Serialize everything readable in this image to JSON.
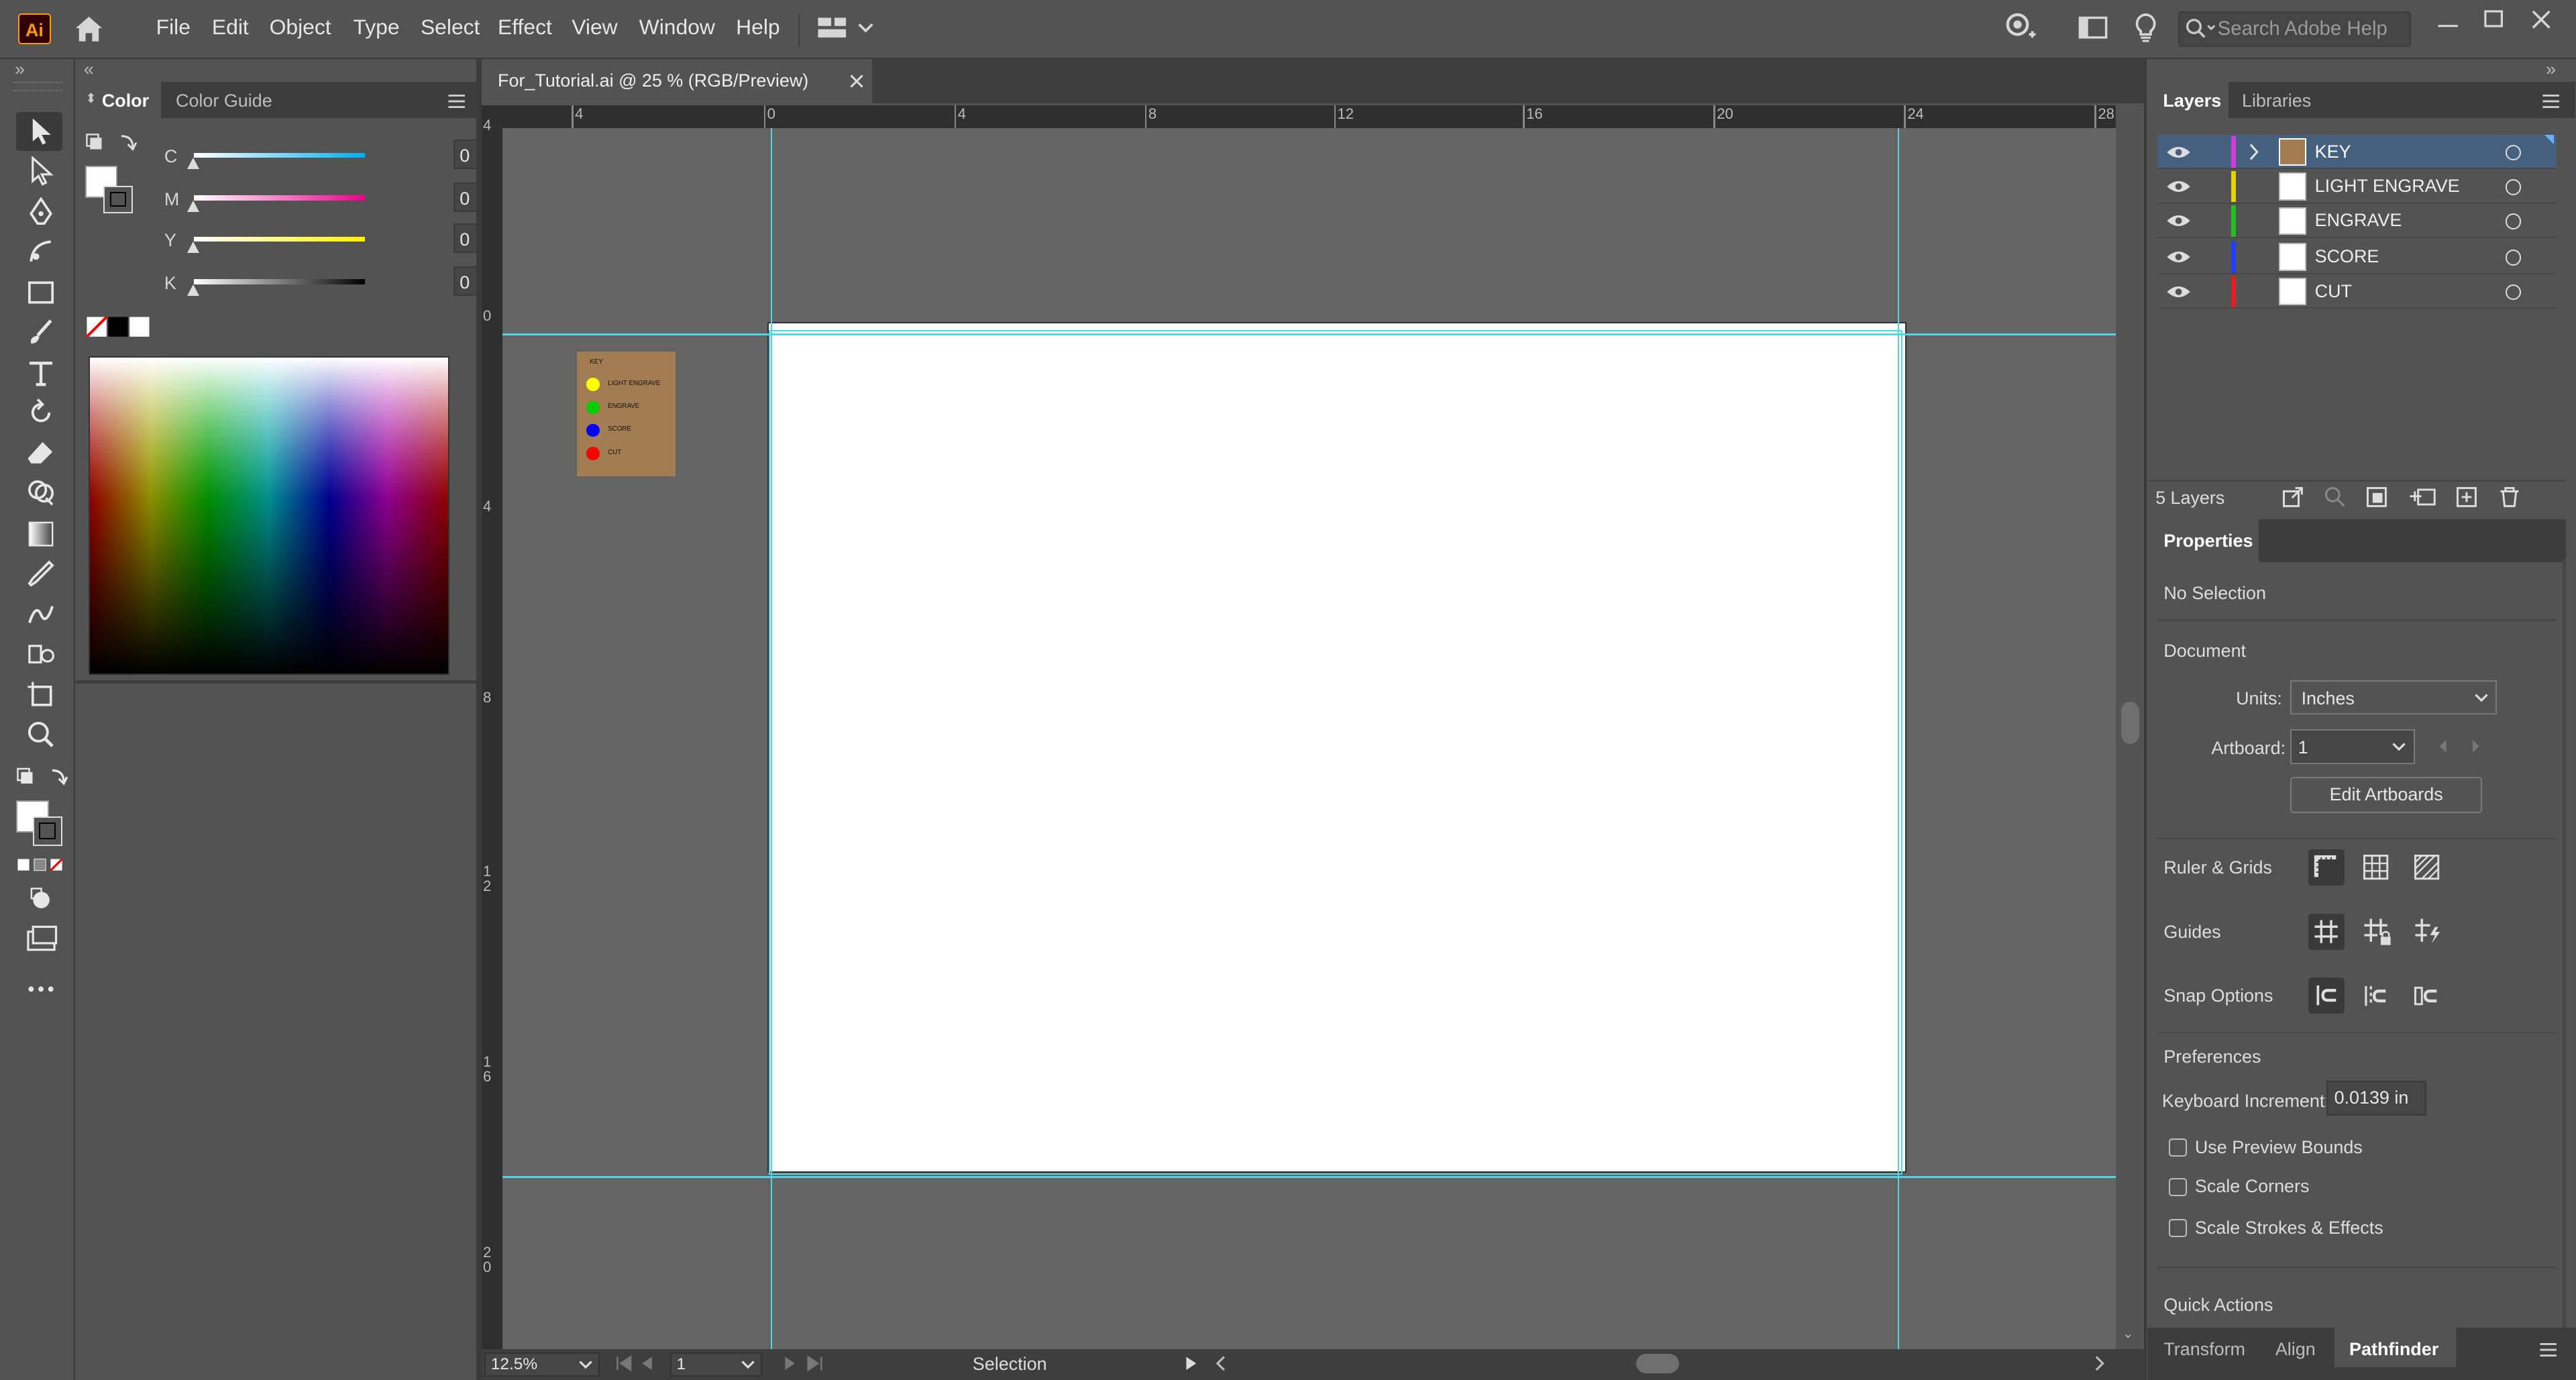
{
  "app": {
    "logo": "Ai"
  },
  "menu": [
    "File",
    "Edit",
    "Object",
    "Type",
    "Select",
    "Effect",
    "View",
    "Window",
    "Help"
  ],
  "search": {
    "placeholder": "Search Adobe Help"
  },
  "left_panel": {
    "tabs": [
      "Color",
      "Color Guide"
    ],
    "channels": [
      {
        "label": "C",
        "value": "0",
        "unit": "%"
      },
      {
        "label": "M",
        "value": "0",
        "unit": "%"
      },
      {
        "label": "Y",
        "value": "0",
        "unit": "%"
      },
      {
        "label": "K",
        "value": "0",
        "unit": "%"
      }
    ]
  },
  "document": {
    "tab_title": "For_Tutorial.ai @ 25 % (RGB/Preview)",
    "h_ruler": [
      "4",
      "0",
      "4",
      "8",
      "12",
      "16",
      "20",
      "24",
      "28"
    ],
    "v_ruler": [
      "4",
      "0",
      "4",
      "8",
      "1\n2",
      "1\n6",
      "2\n0"
    ],
    "key_card": {
      "title": "KEY",
      "items": [
        {
          "label": "LIGHT ENGRAVE",
          "color": "#ffff00"
        },
        {
          "label": "ENGRAVE",
          "color": "#00cc00"
        },
        {
          "label": "SCORE",
          "color": "#0000ff"
        },
        {
          "label": "CUT",
          "color": "#ff0000"
        }
      ],
      "bg": "#a27c52"
    },
    "guide_color": "#4fd7e8"
  },
  "status": {
    "zoom": "12.5%",
    "artboard": "1",
    "tool": "Selection"
  },
  "layers_panel": {
    "tabs": [
      "Layers",
      "Libraries"
    ],
    "layers": [
      {
        "name": "KEY",
        "color": "#d13be0",
        "selected": true,
        "expandable": true
      },
      {
        "name": "LIGHT ENGRAVE",
        "color": "#e6d400",
        "selected": false
      },
      {
        "name": "ENGRAVE",
        "color": "#22c022",
        "selected": false
      },
      {
        "name": "SCORE",
        "color": "#2040ff",
        "selected": false
      },
      {
        "name": "CUT",
        "color": "#e02020",
        "selected": false
      }
    ],
    "count": "5 Layers"
  },
  "properties": {
    "title": "Properties",
    "selection": "No Selection",
    "document_label": "Document",
    "units_label": "Units:",
    "units_value": "Inches",
    "artboard_label": "Artboard:",
    "artboard_value": "1",
    "edit_artboards": "Edit Artboards",
    "ruler_grids": "Ruler & Grids",
    "guides": "Guides",
    "snap_options": "Snap Options",
    "preferences": "Preferences",
    "keyboard_increment_label": "Keyboard Increment:",
    "keyboard_increment_value": "0.0139 in",
    "checkboxes": [
      "Use Preview Bounds",
      "Scale Corners",
      "Scale Strokes & Effects"
    ],
    "quick_actions": "Quick Actions"
  },
  "bottom_tabs": [
    "Transform",
    "Align",
    "Pathfinder"
  ]
}
